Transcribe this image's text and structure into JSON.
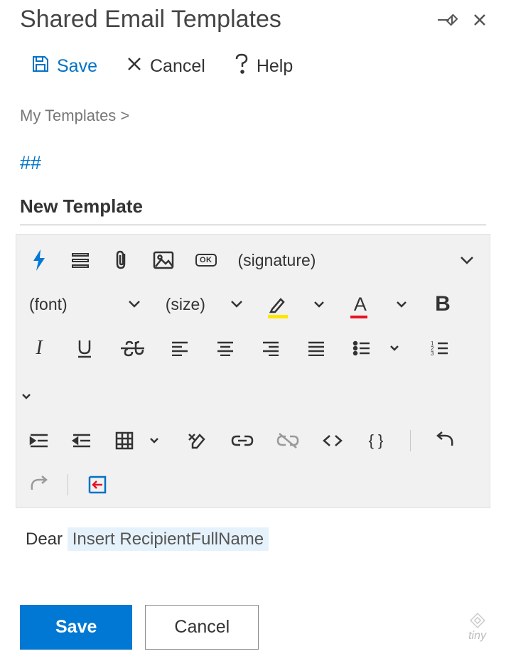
{
  "header": {
    "title": "Shared Email Templates"
  },
  "actions": {
    "save": "Save",
    "cancel": "Cancel",
    "help": "Help"
  },
  "breadcrumb": {
    "path": "My Templates >"
  },
  "hash": "##",
  "template": {
    "title": "New Template"
  },
  "toolbar": {
    "signature_label": "(signature)",
    "font_label": "(font)",
    "size_label": "(size)",
    "ok_badge": "OK",
    "bold_glyph": "B",
    "fontcolor_glyph": "A",
    "italic_glyph": "I",
    "code_glyph": "{ }"
  },
  "content": {
    "greeting": "Dear ",
    "token": "Insert RecipientFullName"
  },
  "footer": {
    "save": "Save",
    "cancel": "Cancel",
    "powered_by": "tiny"
  },
  "colors": {
    "accent": "#0078D4",
    "link": "#0072C6",
    "highlight": "#ffe600",
    "fontcolor": "#e81123"
  }
}
